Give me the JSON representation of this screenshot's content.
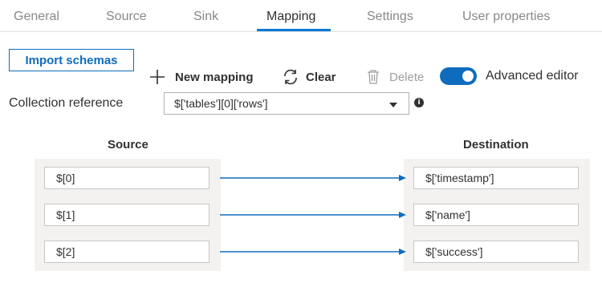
{
  "tabs": [
    {
      "label": "General"
    },
    {
      "label": "Source"
    },
    {
      "label": "Sink"
    },
    {
      "label": "Mapping",
      "active": true
    },
    {
      "label": "Settings"
    },
    {
      "label": "User properties"
    }
  ],
  "toolbar": {
    "import_schemas": "Import schemas",
    "new_mapping": "New mapping",
    "clear": "Clear",
    "delete": "Delete",
    "advanced_editor": "Advanced editor",
    "advanced_editor_on": true
  },
  "collection_reference": {
    "label": "Collection reference",
    "value": "$['tables'][0]['rows']"
  },
  "mapping": {
    "source_header": "Source",
    "destination_header": "Destination",
    "rows": [
      {
        "source": "$[0]",
        "destination": "$['timestamp']"
      },
      {
        "source": "$[1]",
        "destination": "$['name']"
      },
      {
        "source": "$[2]",
        "destination": "$['success']"
      }
    ]
  },
  "colors": {
    "accent": "#0078d4",
    "link_blue": "#0f6cbd",
    "disabled": "#a19f9d"
  }
}
